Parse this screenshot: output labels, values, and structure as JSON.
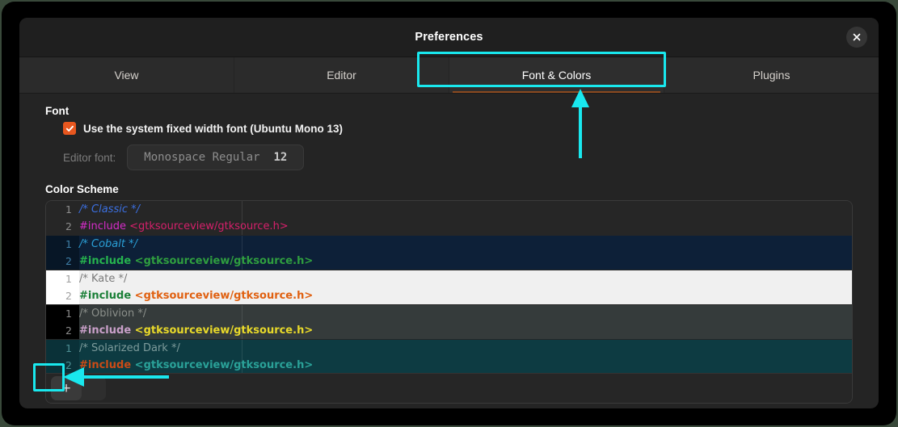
{
  "window": {
    "title": "Preferences",
    "close_icon": "close-icon",
    "close_label": "Close"
  },
  "tabs": [
    {
      "label": "View",
      "active": false
    },
    {
      "label": "Editor",
      "active": false
    },
    {
      "label": "Font & Colors",
      "active": true
    },
    {
      "label": "Plugins",
      "active": false
    }
  ],
  "font_section": {
    "title": "Font",
    "use_system_font": {
      "label": "Use the system fixed width font (Ubuntu Mono 13)",
      "checked": true,
      "icon": "checkmark-icon"
    },
    "editor_font": {
      "label": "Editor font:",
      "value_name": "Monospace Regular",
      "value_size": "12"
    }
  },
  "color_scheme_section": {
    "title": "Color Scheme",
    "schemes": [
      {
        "name": "Classic",
        "comment_text": "/* Classic */",
        "include_text": "#include",
        "header_text": " <gtksourceview/gtksource.h>",
        "line1": "1",
        "line2": "2",
        "selected": false
      },
      {
        "name": "Cobalt",
        "comment_text": "/* Cobalt */",
        "include_text": "#include",
        "header_text": " <gtksourceview/gtksource.h>",
        "line1": "1",
        "line2": "2",
        "selected": true
      },
      {
        "name": "Kate",
        "comment_text": "/* Kate */",
        "include_text": "#include",
        "header_text": " <gtksourceview/gtksource.h>",
        "line1": "1",
        "line2": "2",
        "selected": false
      },
      {
        "name": "Oblivion",
        "comment_text": "/* Oblivion */",
        "include_text": "#include",
        "header_text": " <gtksourceview/gtksource.h>",
        "line1": "1",
        "line2": "2",
        "selected": false
      },
      {
        "name": "Solarized Dark",
        "comment_text": "/* Solarized Dark */",
        "include_text": "#include",
        "header_text": " <gtksourceview/gtksource.h>",
        "line1": "1",
        "line2": "2",
        "selected": false
      }
    ],
    "toolbar": {
      "add_label": "+",
      "add_name": "add-scheme-button"
    }
  },
  "theme_colors": {
    "window_bg": "#242424",
    "headerbar_bg": "#1f1f1f",
    "tabbar_bg": "#2b2b2b",
    "active_tab_underline": "#8b4a20",
    "checkbox_accent": "#e8571f",
    "annotation": "#19e8ee",
    "backdrop": "#000000",
    "outer_bg": "#39493a"
  },
  "scheme_styles": {
    "Classic": {
      "bg": "#262626",
      "gutter_bg": "#262626",
      "gutter_fg": "#8d8d8d",
      "comment": "#3b6fe0",
      "include": "#d62cc9",
      "header": "#d6206b",
      "comment_italic": true,
      "include_bold": false,
      "pane_w": 242
    },
    "Cobalt": {
      "bg": "#0d2038",
      "gutter_bg": "#071626",
      "gutter_fg": "#3f7fa8",
      "comment": "#2a9fd6",
      "include": "#26b34e",
      "header": "#2f9e3f",
      "comment_italic": true,
      "include_bold": true,
      "pane_w": 242
    },
    "Kate": {
      "bg": "#f0f0f0",
      "gutter_bg": "#ffffff",
      "gutter_fg": "#a0a0a0",
      "comment": "#7a7a7a",
      "include": "#1a7f37",
      "header": "#e06010",
      "comment_italic": false,
      "include_bold": true,
      "pane_w": 242
    },
    "Oblivion": {
      "bg": "#353b3b",
      "gutter_bg": "#000000",
      "gutter_fg": "#8d8d8d",
      "comment": "#8b8f8a",
      "include": "#c9a0c9",
      "header": "#e8d92a",
      "comment_italic": false,
      "include_bold": true,
      "pane_w": 242
    },
    "Solarized Dark": {
      "bg": "#0d3b42",
      "gutter_bg": "#0a3138",
      "gutter_fg": "#4d8f94",
      "comment": "#7d9b9b",
      "include": "#cb4b16",
      "header": "#2aa198",
      "comment_italic": false,
      "include_bold": true,
      "pane_w": 242
    }
  },
  "annotations": {
    "tab_highlight": {
      "name": "font-colors-tab-highlight"
    },
    "tab_arrow": {
      "name": "tab-pointer-arrow"
    },
    "add_highlight": {
      "name": "add-button-highlight"
    },
    "add_arrow": {
      "name": "add-button-pointer-arrow"
    }
  }
}
